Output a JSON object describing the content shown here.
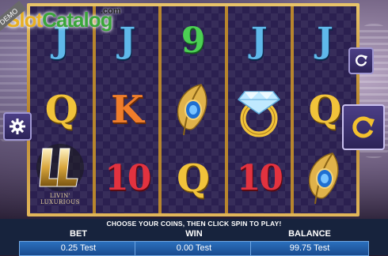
{
  "branding": {
    "site_logo_part1": "Slot",
    "site_logo_part2": "Catalog",
    "site_logo_suffix": ".com",
    "demo_badge": "DEMO"
  },
  "game_logo": {
    "letters": "LL",
    "caption": "LIVIN' LUXURIOUS"
  },
  "reels": [
    [
      "J",
      "Q",
      "wild-logo"
    ],
    [
      "J",
      "K",
      "10"
    ],
    [
      "9",
      "peacock-feather",
      "Q"
    ],
    [
      "J",
      "diamond-ring",
      "10"
    ],
    [
      "J",
      "Q",
      "peacock-feather"
    ]
  ],
  "controls": {
    "refresh_icon": "refresh-icon",
    "spin_icon": "spin-arrow-icon",
    "settings_icon": "gear-icon"
  },
  "message": "CHOOSE YOUR COINS, THEN CLICK SPIN TO PLAY!",
  "bet": {
    "label": "BET",
    "value": "0.25 Test"
  },
  "win": {
    "label": "WIN",
    "value": "0.00 Test"
  },
  "balance": {
    "label": "BALANCE",
    "value": "99.75 Test"
  }
}
